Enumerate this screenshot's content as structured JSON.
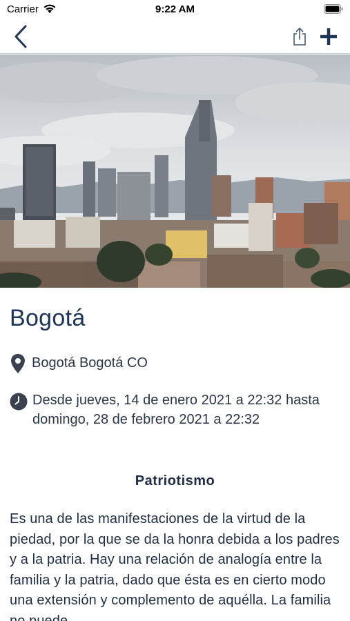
{
  "status_bar": {
    "carrier": "Carrier",
    "time": "9:22 AM",
    "icons": [
      "wifi-icon",
      "battery-icon"
    ]
  },
  "nav_bar": {
    "icons": [
      "back-chevron-icon",
      "share-icon",
      "plus-icon"
    ],
    "accent_color": "#1f3558"
  },
  "hero": {
    "image": "bogota-city-skyline-photo"
  },
  "event": {
    "title": "Bogotá",
    "location": "Bogotá Bogotá CO",
    "date_range": "Desde jueves, 14 de enero 2021 a 22:32 hasta domingo, 28 de febrero 2021 a 22:32",
    "icons": [
      "location-pin-icon",
      "clock-icon"
    ]
  },
  "section": {
    "heading": "Patriotismo",
    "body": "Es una de las manifestaciones de la virtud de la piedad, por la que se da la honra debida a los padres y a la patria. Hay una relación de analogía entre la familia y la patria, dado que ésta es en cierto modo una extensión y complemento de aquélla. La familia no puede"
  }
}
